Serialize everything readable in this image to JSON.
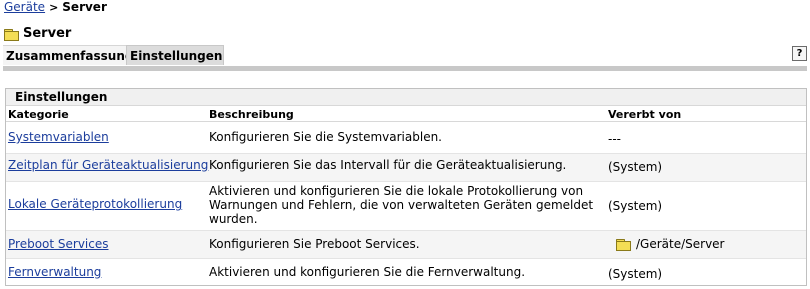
{
  "breadcrumb": {
    "link": "Geräte",
    "separator": ">",
    "current": "Server"
  },
  "page": {
    "title": "Server",
    "title_icon": "folder-icon"
  },
  "tabs": [
    {
      "label": "Zusammenfassung"
    },
    {
      "label": "Einstellungen"
    }
  ],
  "help": {
    "label": "?"
  },
  "panel": {
    "title": "Einstellungen",
    "columns": {
      "kategorie": "Kategorie",
      "beschreibung": "Beschreibung",
      "vererbt": "Vererbt von"
    },
    "rows": [
      {
        "kategorie": "Systemvariablen",
        "beschreibung": "Konfigurieren Sie die Systemvariablen.",
        "vererbt": "---"
      },
      {
        "kategorie": "Zeitplan für Geräteaktualisierung",
        "beschreibung": "Konfigurieren Sie das Intervall für die Geräteaktualisierung.",
        "vererbt": "(System)"
      },
      {
        "kategorie": "Lokale Geräteprotokollierung",
        "beschreibung": "Aktivieren und konfigurieren Sie die lokale Protokollierung von Warnungen und Fehlern, die von verwalteten Geräten gemeldet wurden.",
        "vererbt": "(System)"
      },
      {
        "kategorie": "Preboot Services",
        "beschreibung": "Konfigurieren Sie Preboot Services.",
        "vererbt": "/Geräte/Server",
        "vererbt_icon": "folder-icon"
      },
      {
        "kategorie": "Fernverwaltung",
        "beschreibung": "Aktivieren und konfigurieren Sie die Fernverwaltung.",
        "vererbt": "(System)"
      }
    ]
  },
  "colors": {
    "link": "#1b3d9c",
    "folder": "#f4de55",
    "tab_active": "#dcdcdc",
    "row_alt": "#f5f5f5"
  }
}
